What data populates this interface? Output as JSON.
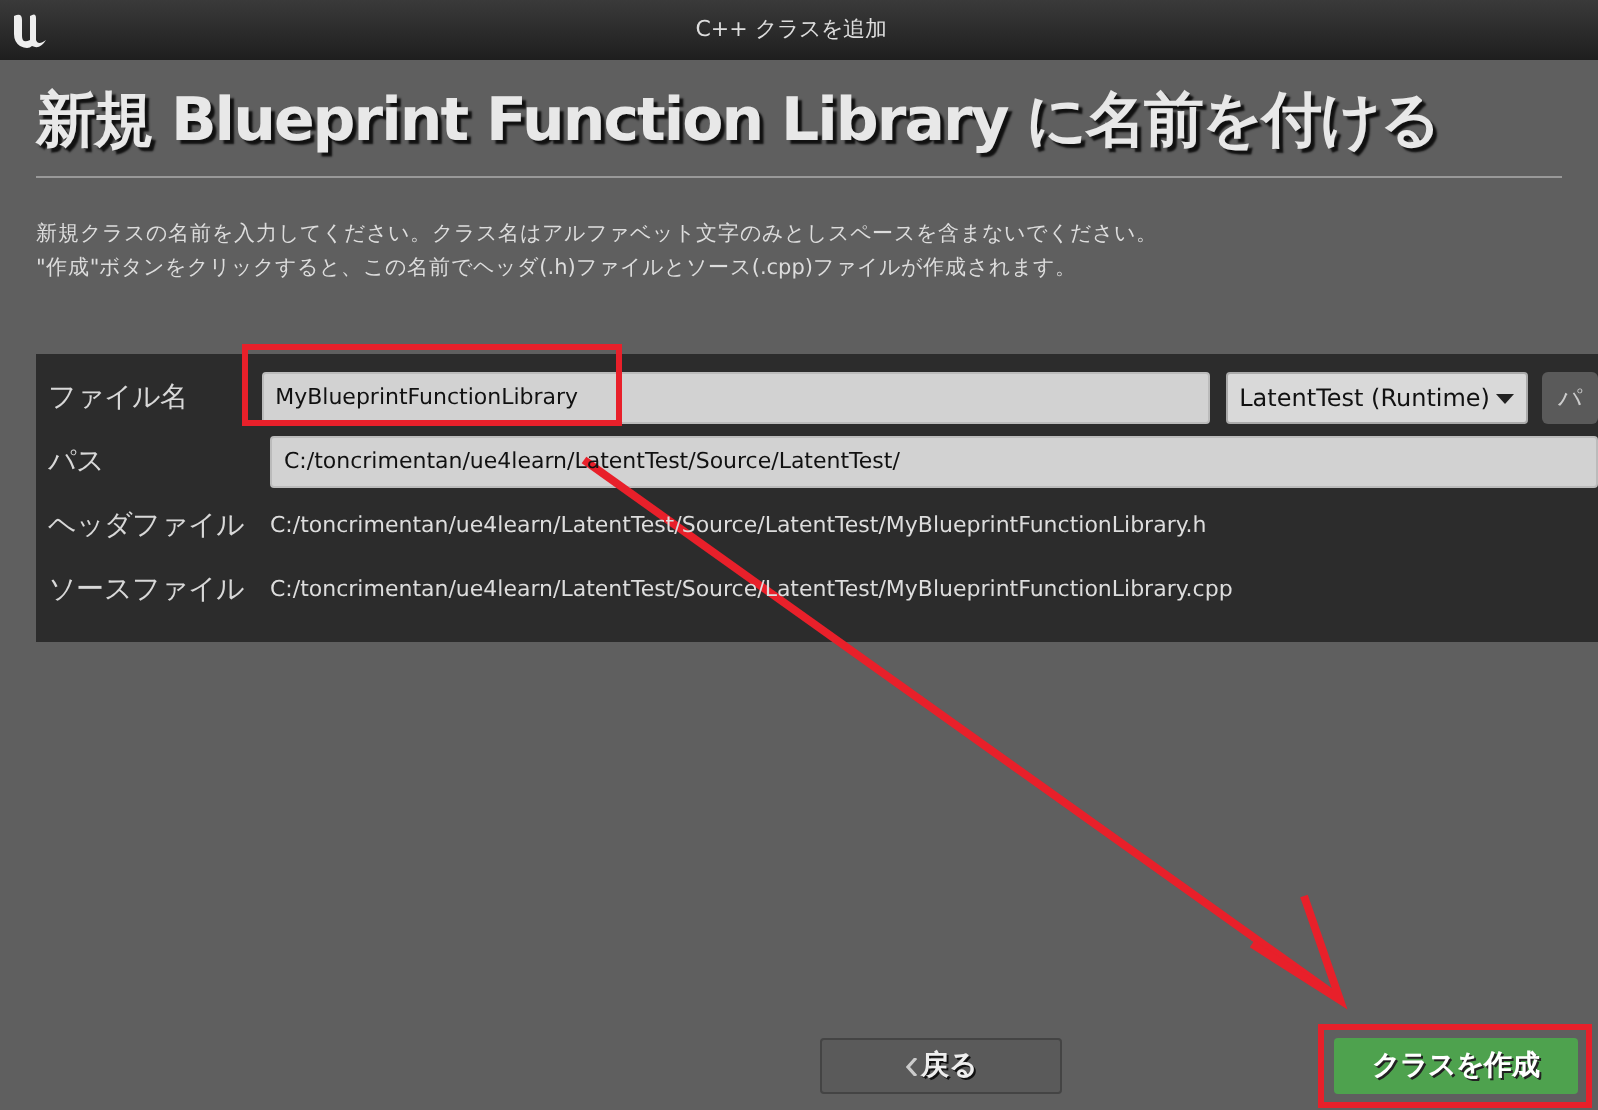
{
  "window": {
    "title": "C++ クラスを追加"
  },
  "heading": "新規 Blueprint Function Library に名前を付ける",
  "description": [
    "新規クラスの名前を入力してください。クラス名はアルファベット文字のみとしスペースを含まないでください。",
    "\"作成\"ボタンをクリックすると、この名前でヘッダ(.h)ファイルとソース(.cpp)ファイルが作成されます。"
  ],
  "form": [
    {
      "kind": "name",
      "label": "ファイル名",
      "value": "MyBlueprintFunctionLibrary",
      "module": "LatentTest (Runtime)",
      "extra_button": "パ"
    },
    {
      "kind": "path",
      "label": "パス",
      "value": "C:/toncrimentan/ue4learn/LatentTest/Source/LatentTest/"
    },
    {
      "kind": "text",
      "label": "ヘッダファイル",
      "value": "C:/toncrimentan/ue4learn/LatentTest/Source/LatentTest/MyBlueprintFunctionLibrary.h"
    },
    {
      "kind": "text",
      "label": "ソースファイル",
      "value": "C:/toncrimentan/ue4learn/LatentTest/Source/LatentTest/MyBlueprintFunctionLibrary.cpp"
    }
  ],
  "buttons": {
    "back": "戻る",
    "create": "クラスを作成"
  }
}
